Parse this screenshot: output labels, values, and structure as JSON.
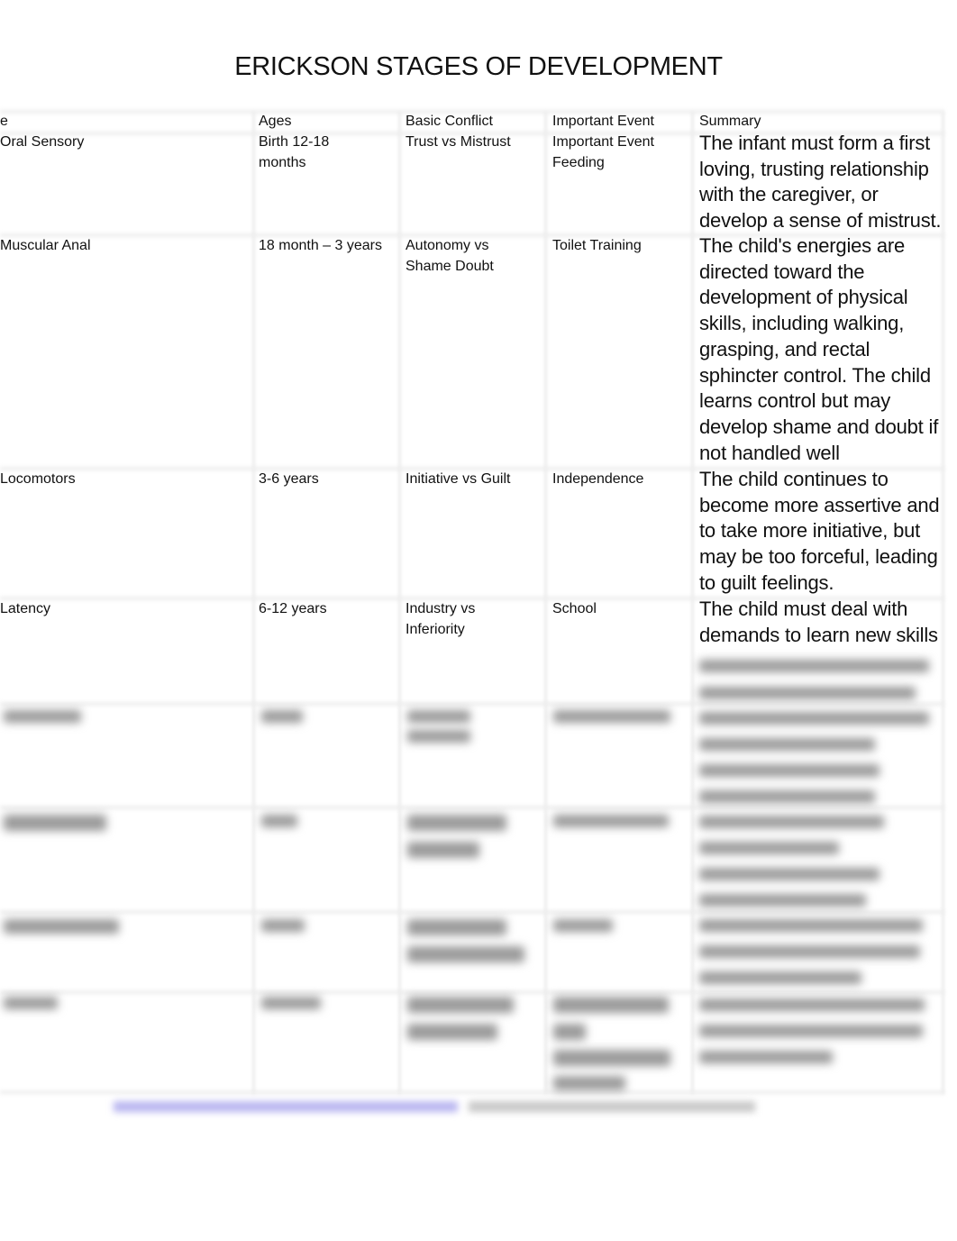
{
  "title": "ERICKSON STAGES OF DEVELOPMENT",
  "table": {
    "headers": [
      "e",
      "Ages",
      "Basic Conflict",
      "Important Event",
      "Summary"
    ],
    "rows": [
      {
        "stage": "Oral Sensory",
        "ages": "Birth 12-18 months",
        "conflict": "Trust vs Mistrust",
        "event": "Important Event Feeding",
        "summary": "The infant must form a first loving, trusting relationship with the caregiver, or develop a sense of mistrust."
      },
      {
        "stage": "Muscular Anal",
        "ages": "18 month – 3 years",
        "conflict": "Autonomy vs Shame Doubt",
        "event": "Toilet Training",
        "summary": "The child's energies are directed toward the development of physical skills, including walking, grasping, and rectal sphincter control. The child learns control but may develop shame and doubt if not handled well"
      },
      {
        "stage": "Locomotors",
        "ages": "3-6 years",
        "conflict": "Initiative vs Guilt",
        "event": "Independence",
        "summary": "The child continues to become more assertive and to take more initiative, but may be too forceful, leading to guilt feelings."
      },
      {
        "stage": "Latency",
        "ages": "6-12 years",
        "conflict": "Industry vs Inferiority",
        "event": "School",
        "summary": "The child must deal with demands to learn new skills"
      }
    ]
  },
  "colors": {
    "grid": "#ececec",
    "blurred_text": "#9a9a9a",
    "blurred_link": "#b9b6f0"
  }
}
